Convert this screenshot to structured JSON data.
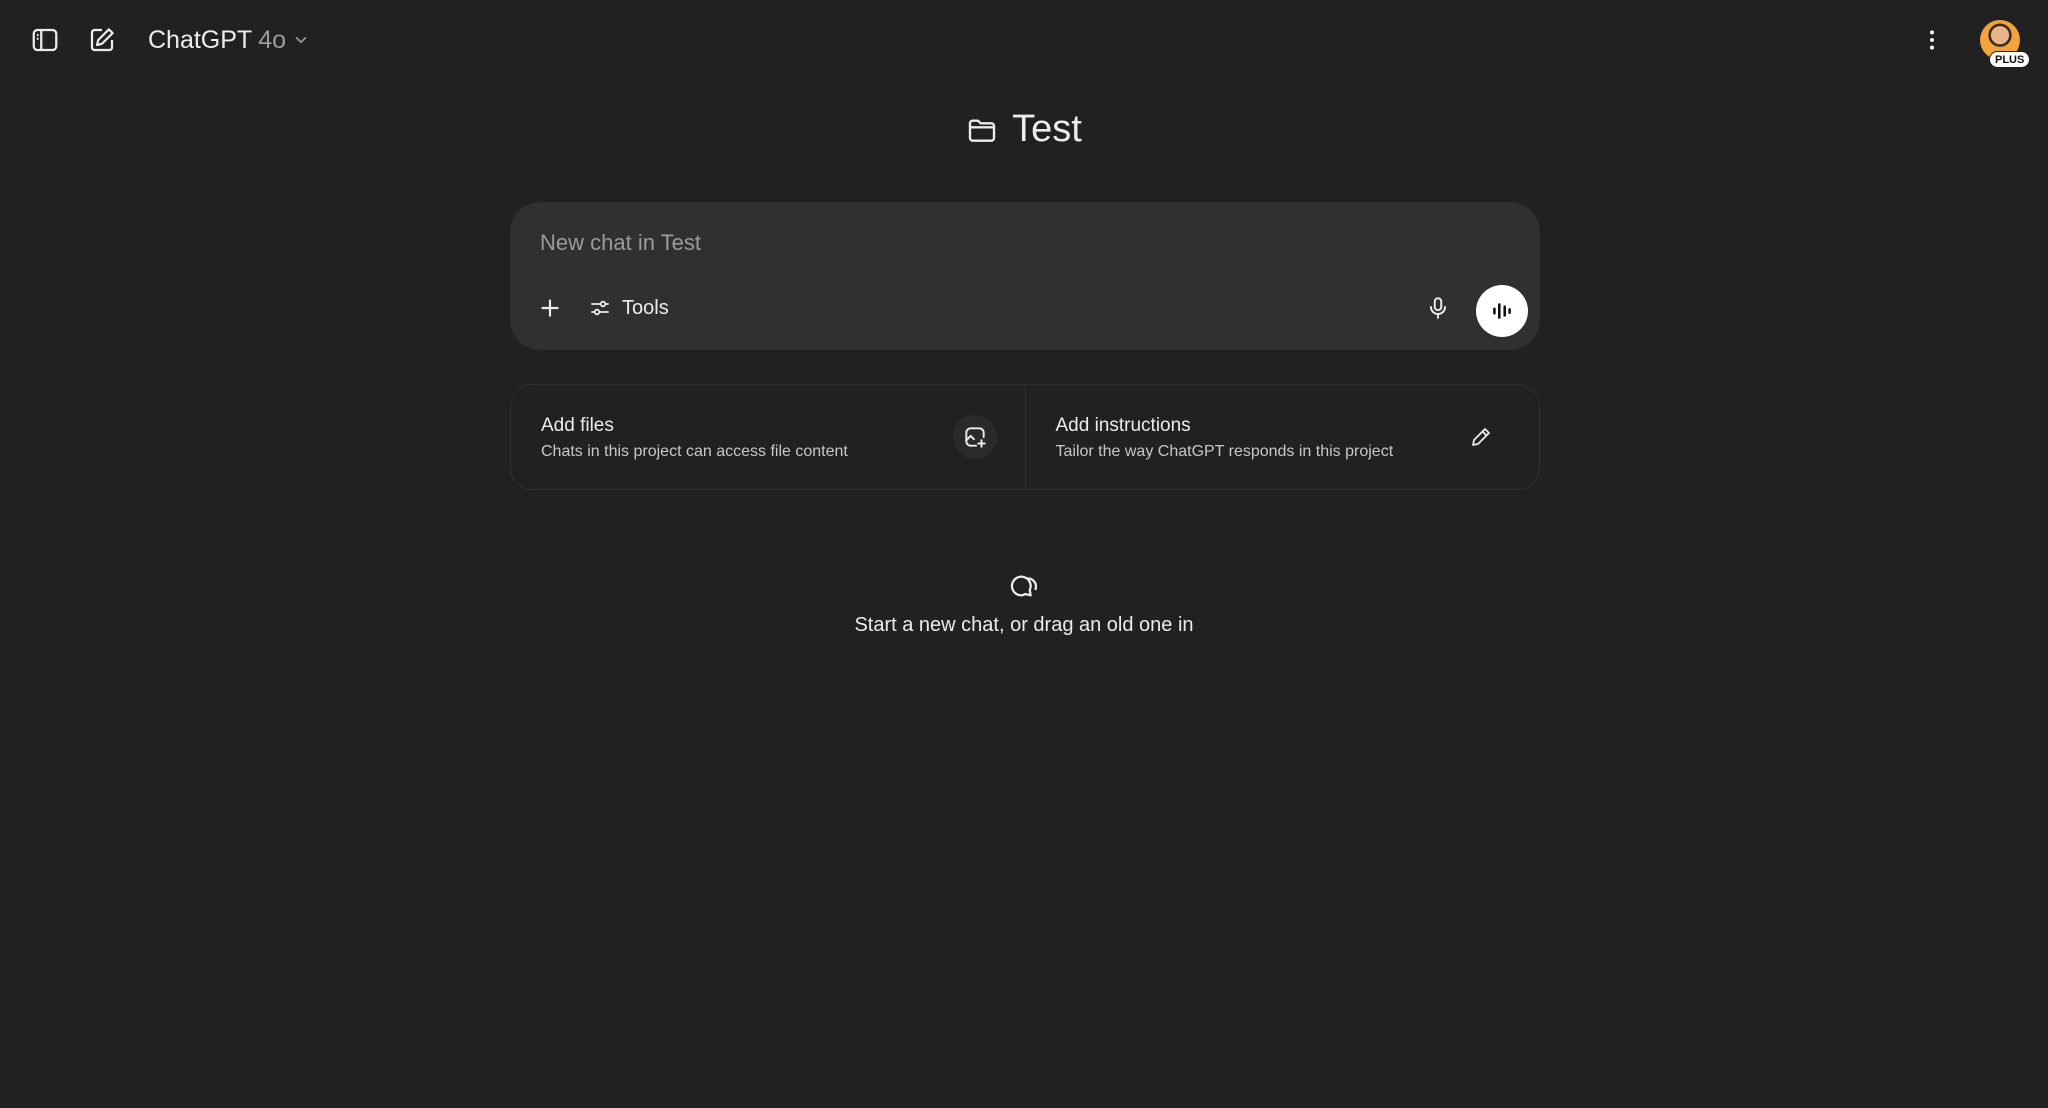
{
  "topbar": {
    "model_name": "ChatGPT",
    "model_version": "4o",
    "plan_badge": "PLUS",
    "icons": {
      "sidebar_toggle": "sidebar-toggle-icon",
      "new_chat": "new-chat-icon",
      "model_dropdown": "chevron-down-icon",
      "more": "more-vertical-icon"
    }
  },
  "project": {
    "title": "Test",
    "icon": "folder-icon"
  },
  "composer": {
    "placeholder": "New chat in Test",
    "tools_label": "Tools",
    "icons": {
      "add": "plus-icon",
      "tools": "sliders-icon",
      "mic": "microphone-icon",
      "voice": "voice-waveform-icon"
    }
  },
  "cards": {
    "files": {
      "title": "Add files",
      "description": "Chats in this project can access file content",
      "icon": "file-add-icon"
    },
    "instructions": {
      "title": "Add instructions",
      "description": "Tailor the way ChatGPT responds in this project",
      "icon": "pencil-icon"
    }
  },
  "empty_state": {
    "text": "Start a new chat, or drag an old one in",
    "icon": "chat-bubbles-icon"
  },
  "colors": {
    "background": "#212121",
    "composer": "#303030",
    "text": "#ececec",
    "muted": "#9b9b9b"
  }
}
